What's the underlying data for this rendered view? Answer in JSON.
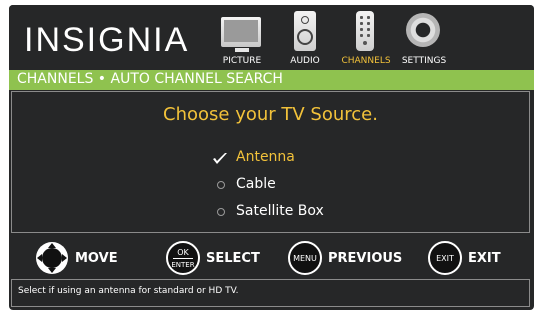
{
  "brand": {
    "logo_text": "INSIGNIA"
  },
  "nav": {
    "items": [
      {
        "label": "PICTURE",
        "icon": "tv-icon",
        "active": false
      },
      {
        "label": "AUDIO",
        "icon": "speaker-icon",
        "active": false
      },
      {
        "label": "CHANNELS",
        "icon": "remote-icon",
        "active": true
      },
      {
        "label": "SETTINGS",
        "icon": "gear-icon",
        "active": false
      }
    ]
  },
  "title_bar": {
    "text": "CHANNELS • AUTO CHANNEL SEARCH"
  },
  "main": {
    "prompt": "Choose your TV Source.",
    "options": [
      {
        "label": "Antenna",
        "selected": true
      },
      {
        "label": "Cable",
        "selected": false
      },
      {
        "label": "Satellite Box",
        "selected": false
      }
    ]
  },
  "controls": [
    {
      "label": "MOVE",
      "icon": "directional-pad-icon",
      "button_text": ""
    },
    {
      "label": "SELECT",
      "icon": "ok-enter-button-icon",
      "button_text": "OK|ENTER"
    },
    {
      "label": "PREVIOUS",
      "icon": "menu-button-icon",
      "button_text": "MENU"
    },
    {
      "label": "EXIT",
      "icon": "exit-button-icon",
      "button_text": "EXIT"
    }
  ],
  "help": {
    "text": "Select if using an antenna for standard or HD TV."
  },
  "colors": {
    "background": "#262728",
    "accent_green": "#8fc24f",
    "highlight_yellow": "#f2c23a",
    "text_white": "#ffffff"
  }
}
